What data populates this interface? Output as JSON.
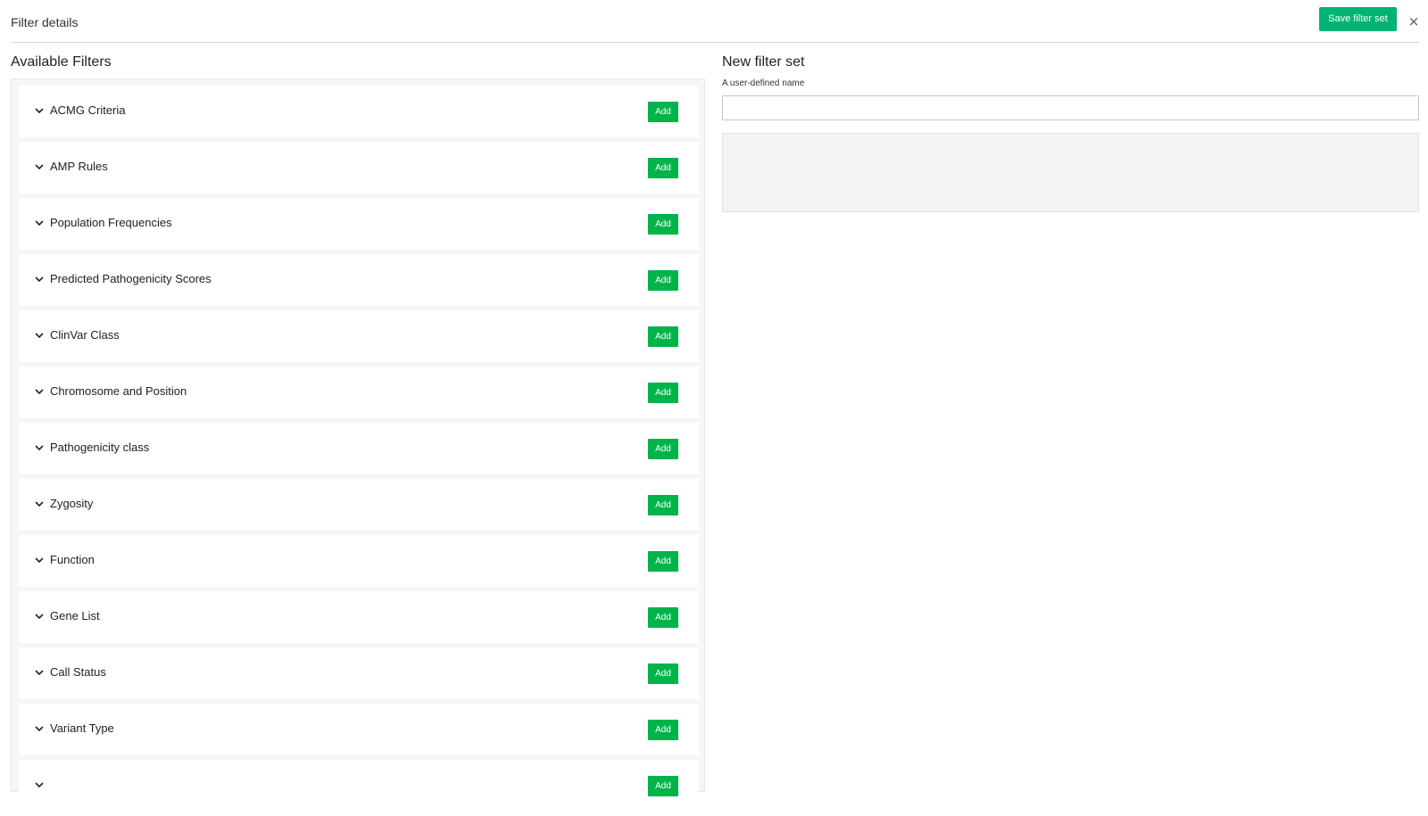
{
  "header": {
    "title": "Filter details",
    "save_label": "Save filter set",
    "close_label": "×"
  },
  "left": {
    "title": "Available Filters",
    "add_label": "Add",
    "filters": [
      {
        "label": "ACMG Criteria"
      },
      {
        "label": "AMP Rules"
      },
      {
        "label": "Population Frequencies"
      },
      {
        "label": "Predicted Pathogenicity Scores"
      },
      {
        "label": "ClinVar Class"
      },
      {
        "label": "Chromosome and Position"
      },
      {
        "label": "Pathogenicity class"
      },
      {
        "label": "Zygosity"
      },
      {
        "label": "Function"
      },
      {
        "label": "Gene List"
      },
      {
        "label": "Call Status"
      },
      {
        "label": "Variant Type"
      },
      {
        "label": ""
      }
    ]
  },
  "right": {
    "title": "New filter set",
    "name_label": "A user-defined name",
    "name_value": ""
  },
  "colors": {
    "save_button": "#00b373",
    "add_button": "#00b34a"
  },
  "icons": {
    "expand": "chevron-down-icon",
    "close": "close-icon"
  }
}
